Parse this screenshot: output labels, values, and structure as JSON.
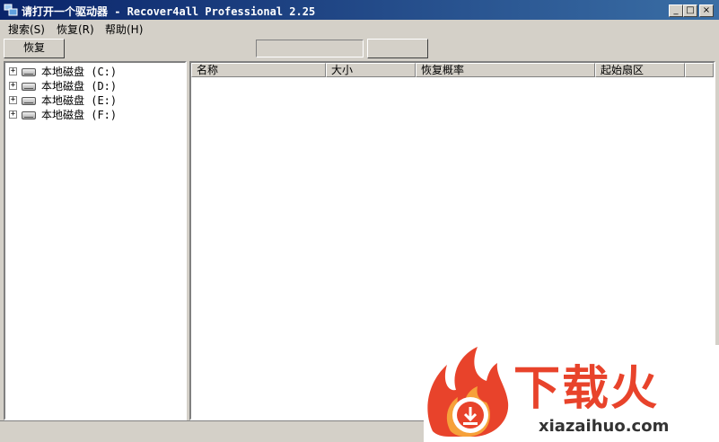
{
  "window": {
    "title": "请打开一个驱动器 - Recover4all Professional 2.25",
    "minimize": "_",
    "maximize": "□",
    "close": "×"
  },
  "menu": {
    "items": [
      {
        "label": "搜索(S)"
      },
      {
        "label": "恢复(R)"
      },
      {
        "label": "帮助(H)"
      }
    ]
  },
  "toolbar": {
    "recover_label": "恢复",
    "progress_text": "",
    "action_label": ""
  },
  "tree": {
    "drives": [
      {
        "expander": "+",
        "label": "本地磁盘 (C:)"
      },
      {
        "expander": "+",
        "label": "本地磁盘 (D:)"
      },
      {
        "expander": "+",
        "label": "本地磁盘 (E:)"
      },
      {
        "expander": "+",
        "label": "本地磁盘 (F:)"
      }
    ]
  },
  "file_list": {
    "columns": [
      "名称",
      "大小",
      "恢复概率",
      "起始扇区"
    ],
    "rows": []
  },
  "statusbar": {
    "text": ""
  },
  "watermark": {
    "brand_cn": "下载火",
    "url": "xiazaihuo.com",
    "colors": {
      "red": "#e8432b",
      "orange": "#f6a13a"
    }
  }
}
